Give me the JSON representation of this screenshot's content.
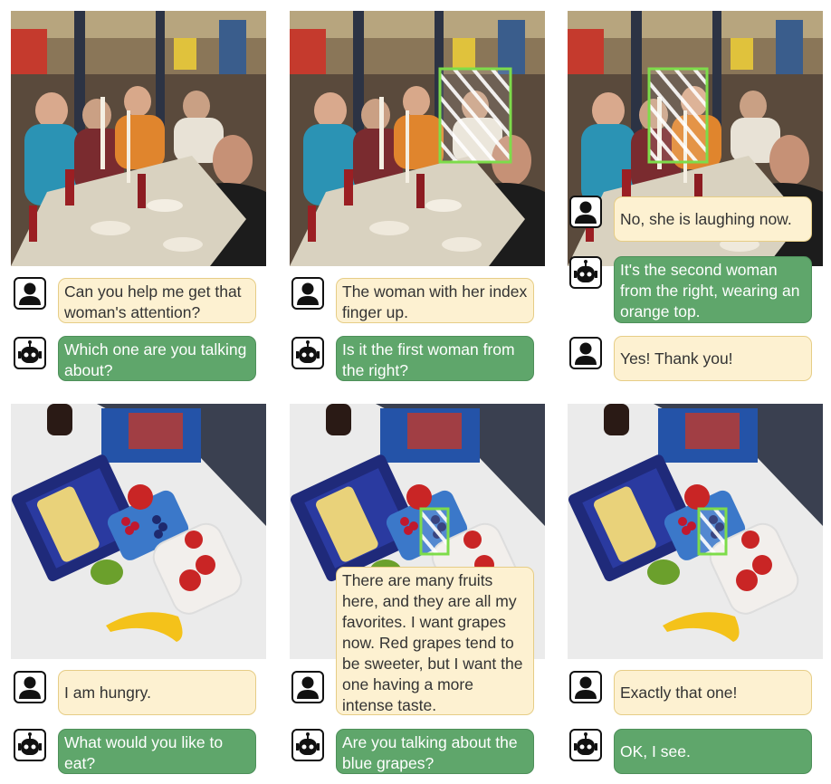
{
  "icons": {
    "human": "person-icon",
    "robot": "robot-icon"
  },
  "colors": {
    "human_bubble": "#fdf1d1",
    "robot_bubble": "#5fa66b",
    "highlight_box": "#7ddc4a"
  },
  "scene1": {
    "dialog1": {
      "human": "Can you help me get that woman's attention?",
      "robot": "Which one are you talking about?"
    },
    "dialog2": {
      "human": "The woman with her index finger up.",
      "robot": "Is it the first woman from the right?"
    },
    "dialog3": {
      "human": "No, she is laughing now.",
      "robot": "It's the second woman from the right, wearing an orange top.",
      "human2": "Yes! Thank you!"
    }
  },
  "scene2": {
    "dialog1": {
      "human": "I am hungry.",
      "robot": "What would you like to eat?"
    },
    "dialog2": {
      "human": "There are many fruits here, and they are all my favorites. I want grapes now. Red grapes tend to be sweeter, but I want the one having a more intense taste.",
      "robot": "Are you talking about the blue grapes?"
    },
    "dialog3": {
      "human": "Exactly that one!",
      "robot": "OK, I see."
    }
  }
}
